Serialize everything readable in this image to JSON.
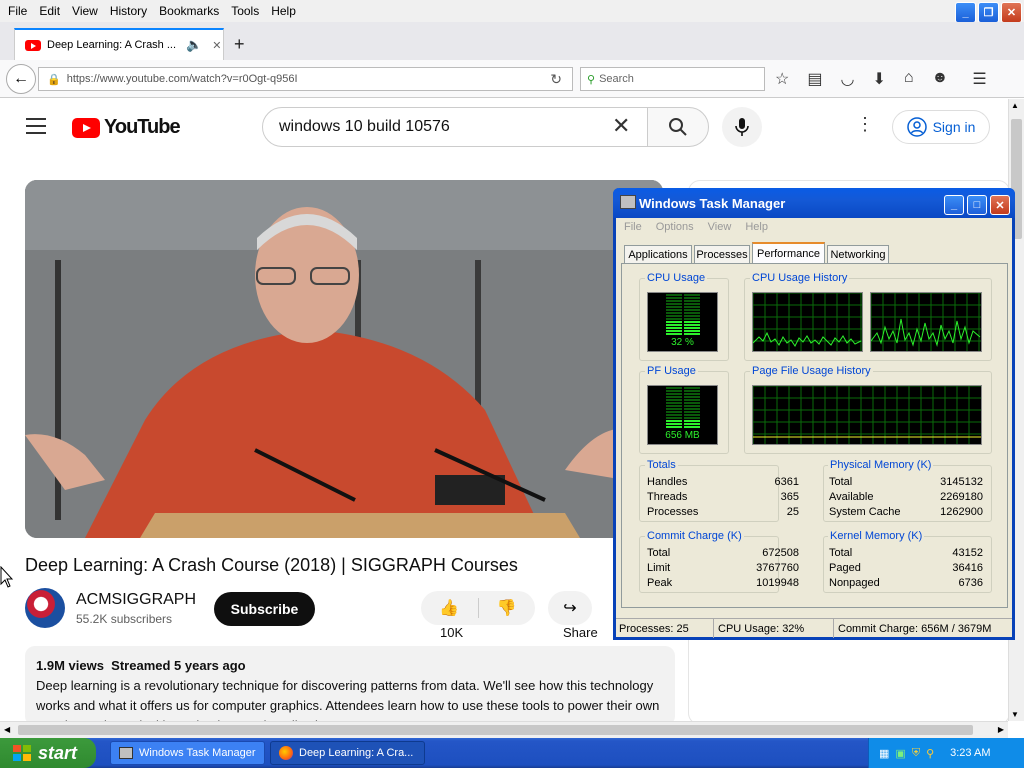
{
  "firefox": {
    "menu": [
      "File",
      "Edit",
      "View",
      "History",
      "Bookmarks",
      "Tools",
      "Help"
    ],
    "tab_title": "Deep Learning: A Crash ...",
    "url": "https://www.youtube.com/watch?v=r0Ogt-q956I",
    "search_placeholder": "Search"
  },
  "youtube": {
    "logo_text": "YouTube",
    "search_query": "windows 10 build 10576",
    "signin": "Sign in",
    "video_title": "Deep Learning: A Crash Course (2018) | SIGGRAPH Courses",
    "channel_name": "ACMSIGGRAPH",
    "subscribers": "55.2K subscribers",
    "subscribe": "Subscribe",
    "likes": "10K",
    "share": "Share",
    "views": "1.9M views",
    "streamed": "Streamed 5 years ago",
    "description": "Deep learning is a revolutionary technique for discovering patterns from data. We'll see how this technology works and what it offers us for computer graphics. Attendees learn how to use these tools to power their own creative and practical investigations and applications."
  },
  "taskmanager": {
    "title": "Windows Task Manager",
    "menu": [
      "File",
      "Options",
      "View",
      "Help"
    ],
    "tabs": [
      "Applications",
      "Processes",
      "Performance",
      "Networking"
    ],
    "active_tab": "Performance",
    "cpu_usage_label": "CPU Usage",
    "cpu_usage_value": "32 %",
    "cpu_history_label": "CPU Usage History",
    "pf_usage_label": "PF Usage",
    "pf_usage_value": "656 MB",
    "pf_history_label": "Page File Usage History",
    "totals": {
      "label": "Totals",
      "rows": [
        [
          "Handles",
          "6361"
        ],
        [
          "Threads",
          "365"
        ],
        [
          "Processes",
          "25"
        ]
      ]
    },
    "physical": {
      "label": "Physical Memory (K)",
      "rows": [
        [
          "Total",
          "3145132"
        ],
        [
          "Available",
          "2269180"
        ],
        [
          "System Cache",
          "1262900"
        ]
      ]
    },
    "commit": {
      "label": "Commit Charge (K)",
      "rows": [
        [
          "Total",
          "672508"
        ],
        [
          "Limit",
          "3767760"
        ],
        [
          "Peak",
          "1019948"
        ]
      ]
    },
    "kernel": {
      "label": "Kernel Memory (K)",
      "rows": [
        [
          "Total",
          "43152"
        ],
        [
          "Paged",
          "36416"
        ],
        [
          "Nonpaged",
          "6736"
        ]
      ]
    },
    "status": [
      "Processes: 25",
      "CPU Usage: 32%",
      "Commit Charge: 656M / 3679M"
    ]
  },
  "taskbar": {
    "start": "start",
    "items": [
      "Windows Task Manager",
      "Deep Learning: A Cra..."
    ],
    "clock": "3:23 AM"
  }
}
